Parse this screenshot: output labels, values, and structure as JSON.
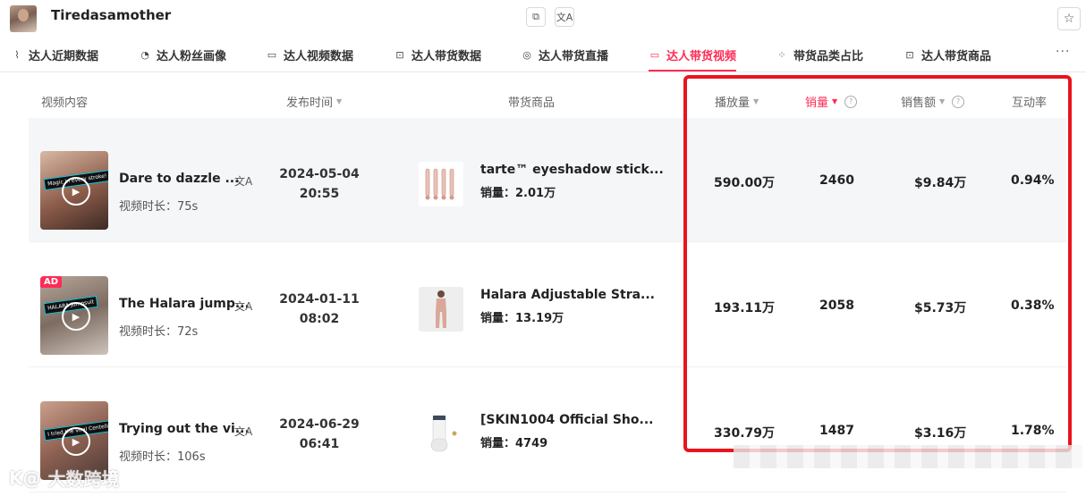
{
  "header": {
    "account_name": "Tiredasamother",
    "copy_glyph": "⧉",
    "translate_glyph": "文A",
    "star_glyph": "☆"
  },
  "tabs": [
    {
      "label": "达人近期数据",
      "icon": "line-chart-icon",
      "glyph": "⌇"
    },
    {
      "label": "达人粉丝画像",
      "icon": "pie-chart-icon",
      "glyph": "◔"
    },
    {
      "label": "达人视频数据",
      "icon": "video-icon",
      "glyph": "▭"
    },
    {
      "label": "达人带货数据",
      "icon": "bag-icon",
      "glyph": "⊡"
    },
    {
      "label": "达人带货直播",
      "icon": "live-icon",
      "glyph": "◎"
    },
    {
      "label": "达人带货视频",
      "icon": "video-icon",
      "glyph": "▭",
      "active": true
    },
    {
      "label": "带货品类占比",
      "icon": "grid-icon",
      "glyph": "⁘"
    },
    {
      "label": "达人带货商品",
      "icon": "bag-icon",
      "glyph": "⊡"
    }
  ],
  "more_glyph": "···",
  "table": {
    "columns": {
      "video": "视频内容",
      "publish_time": "发布时间",
      "product": "带货商品",
      "plays": "播放量",
      "sold": "销量",
      "revenue": "销售额",
      "engagement": "互动率"
    },
    "sort_glyph": "▼",
    "help_glyph": "?",
    "translate_glyph": "文A",
    "play_glyph": "▶",
    "rows": [
      {
        "title": "Dare to dazzle ...",
        "duration": "视频时长：75s",
        "date": "2024-05-04",
        "time": "20:55",
        "product_name": "tarte™ eyeshadow stick...",
        "product_sales": "销量：2.01万",
        "plays": "590.00万",
        "sold": "2460",
        "revenue": "$9.84万",
        "engagement": "0.94%",
        "caption": "Magic in every stroke!"
      },
      {
        "title": "The Halara jump...",
        "duration": "视频时长：72s",
        "date": "2024-01-11",
        "time": "08:02",
        "product_name": "Halara Adjustable Stra...",
        "product_sales": "销量：13.19万",
        "plays": "193.11万",
        "sold": "2058",
        "revenue": "$5.73万",
        "engagement": "0.38%",
        "ad": "AD",
        "caption": "HALARA Jumpsuit"
      },
      {
        "title": "Trying out the vi...",
        "duration": "视频时长：106s",
        "date": "2024-06-29",
        "time": "06:41",
        "product_name": "[SKIN1004 Official Sho...",
        "product_sales": "销量：4749",
        "plays": "330.79万",
        "sold": "1487",
        "revenue": "$3.16万",
        "engagement": "1.78%",
        "caption": "I tried the viral Centella"
      }
    ]
  },
  "watermark": {
    "logo": "K@",
    "text": "大数跨境"
  },
  "colors": {
    "accent": "#fe2c55",
    "highlight_box": "#e8141e",
    "row_highlight": "#f5f6f8"
  }
}
